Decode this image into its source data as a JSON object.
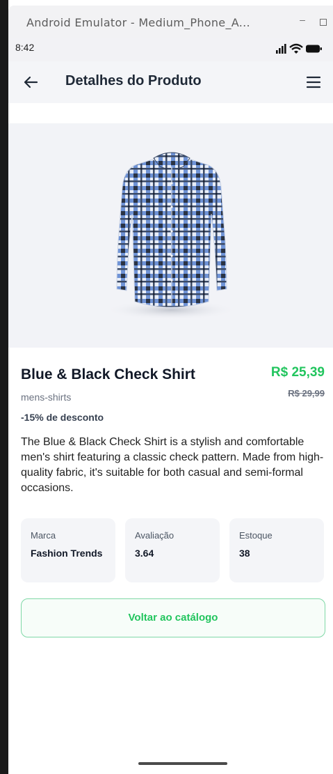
{
  "window": {
    "title": "Android Emulator - Medium_Phone_A...",
    "minimize_glyph": "–"
  },
  "status": {
    "time": "8:42",
    "icons": [
      "signal-icon",
      "wifi-icon",
      "battery-icon"
    ]
  },
  "appbar": {
    "title": "Detalhes do Produto",
    "back_icon": "arrow-left-icon",
    "menu_icon": "hamburger-menu-icon"
  },
  "product": {
    "image_alt": "shirt-image",
    "name": "Blue & Black Check Shirt",
    "price": "R$ 25,39",
    "old_price": "R$ 29,99",
    "category": "mens-shirts",
    "discount": "-15% de desconto",
    "description": "The Blue & Black Check Shirt is a stylish and comfortable men's shirt featuring a classic check pattern. Made from high-quality fabric, it's suitable for both casual and semi-formal occasions."
  },
  "info_cards": [
    {
      "label": "Marca",
      "value": "Fashion Trends"
    },
    {
      "label": "Avaliação",
      "value": "3.64"
    },
    {
      "label": "Estoque",
      "value": "38"
    }
  ],
  "actions": {
    "back_to_catalog": "Voltar ao catálogo"
  },
  "colors": {
    "accent_green": "#22c55e",
    "card_bg": "#f4f5f8",
    "title_text": "#1f2937"
  }
}
